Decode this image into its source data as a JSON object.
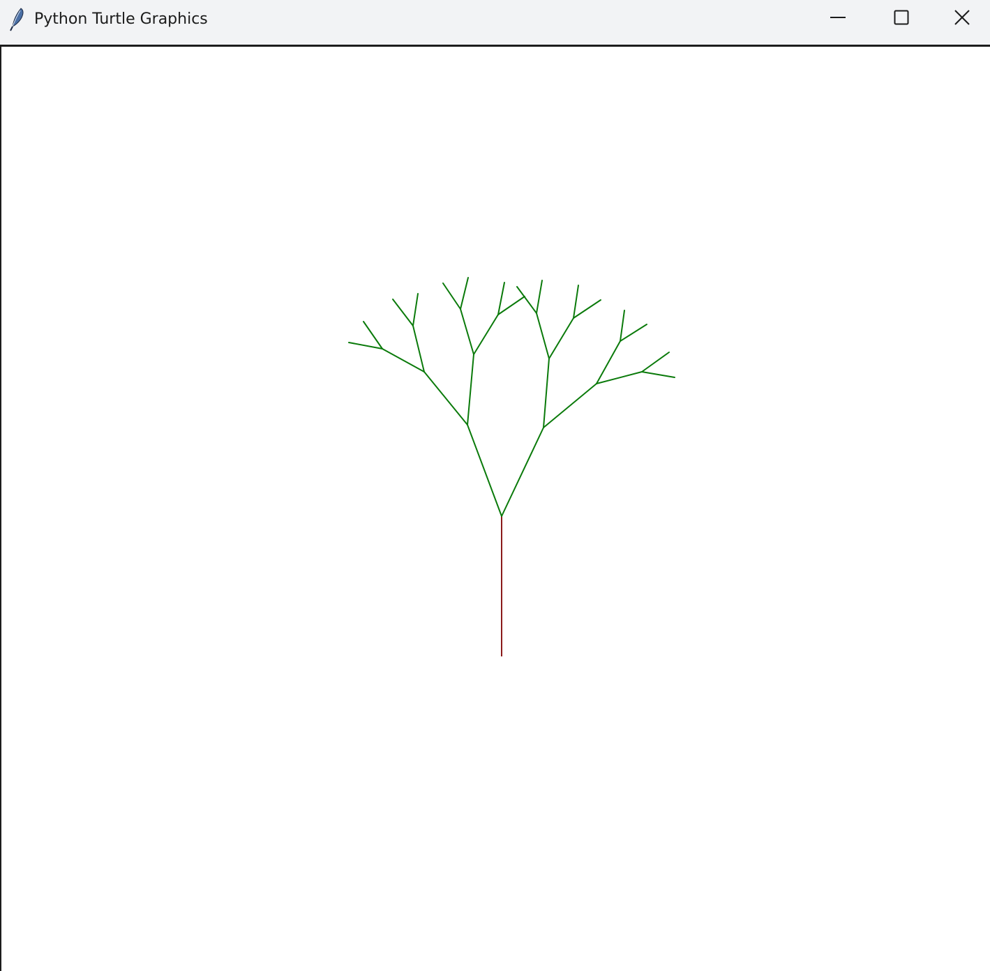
{
  "window": {
    "title": "Python Turtle Graphics",
    "app_icon": "feather-icon",
    "controls": {
      "minimize_icon": "minimize-icon",
      "maximize_icon": "maximize-icon",
      "close_icon": "close-icon"
    }
  },
  "canvas": {
    "background": "#ffffff",
    "trunk_color": "#8b1a1a",
    "branch_color": "#0a7a0a"
  }
}
